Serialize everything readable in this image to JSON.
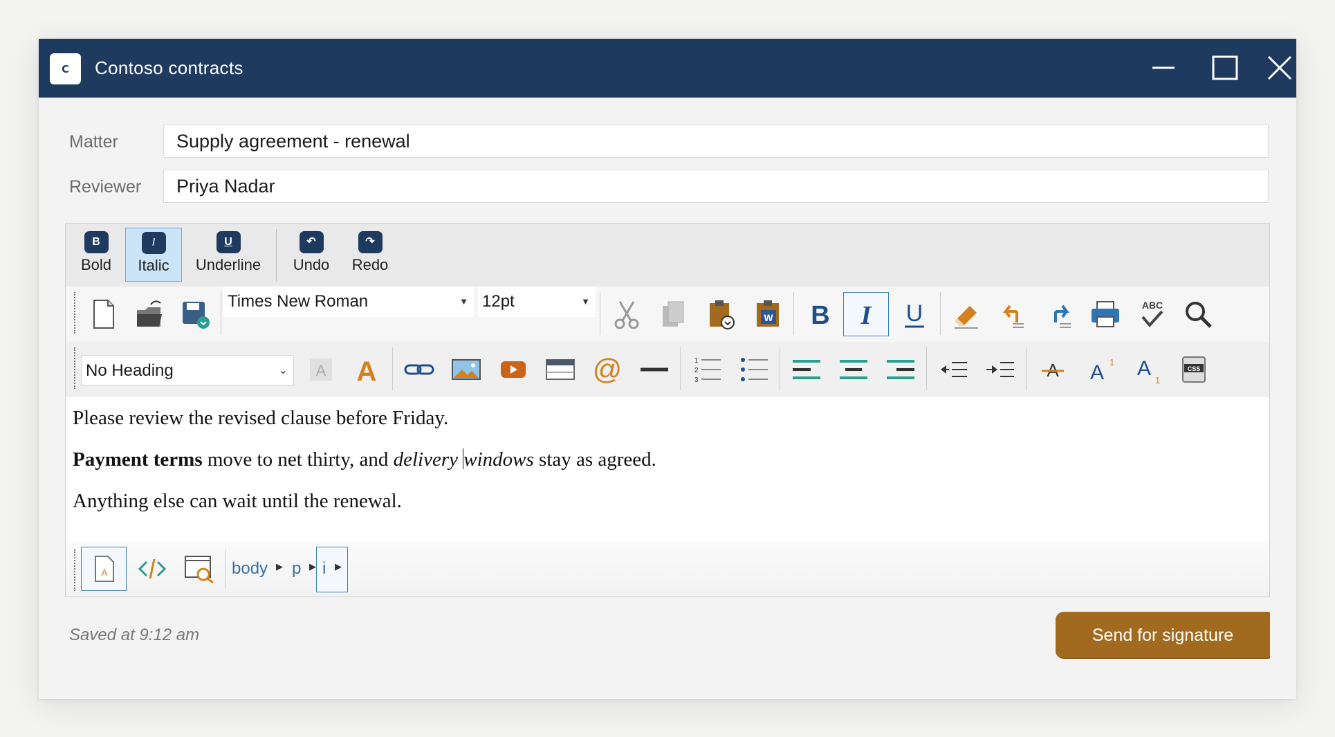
{
  "window": {
    "title": "Contoso contracts",
    "logo_letter": "C"
  },
  "form": {
    "matter_label": "Matter",
    "matter_value": "Supply agreement - renewal",
    "reviewer_label": "Reviewer",
    "reviewer_value": "Priya Nadar"
  },
  "ribbon": {
    "bold": "Bold",
    "bold_icon": "B",
    "italic": "Italic",
    "italic_icon": "I",
    "underline": "Underline",
    "underline_icon": "U",
    "undo": "Undo",
    "redo": "Redo",
    "active": "Italic"
  },
  "toolbar": {
    "font_family": "Times New Roman",
    "font_size": "12pt",
    "heading": "No Heading"
  },
  "document": {
    "p1": "Please review the revised clause before Friday.",
    "p2_bold": "Payment terms",
    "p2_mid": " move to net thirty, and ",
    "p2_italic_a": "delivery ",
    "p2_italic_b": "windows",
    "p2_end": " stay as agreed.",
    "p3": "Anything else can wait until the renewal."
  },
  "statusbar": {
    "path": [
      "body",
      "p",
      "i"
    ]
  },
  "footer": {
    "saved": "Saved at 9:12 am",
    "send_label": "Send for signature"
  },
  "colors": {
    "titlebar": "#1f3a5f",
    "accent_button": "#a16a1e",
    "icon_blue": "#2e75b6",
    "icon_orange": "#d4811f",
    "icon_teal": "#2a9d8f"
  }
}
